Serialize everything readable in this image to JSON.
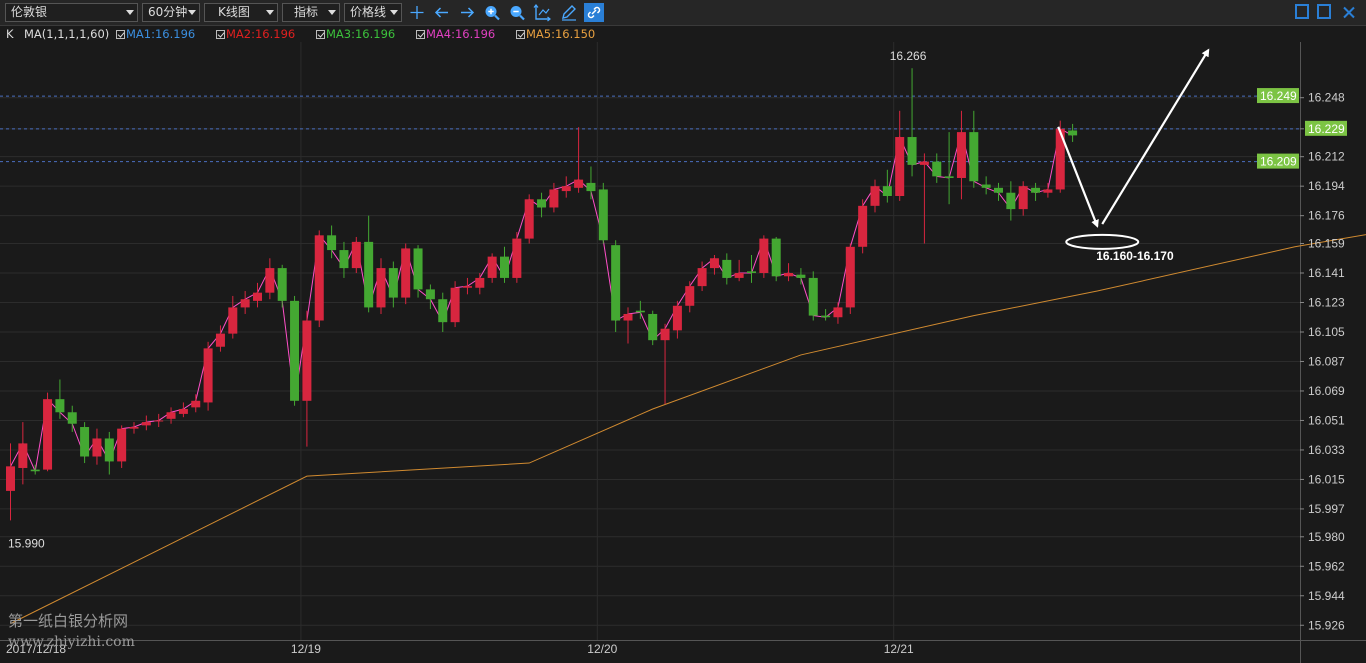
{
  "toolbar": {
    "symbol": "伦敦银",
    "period": "60分钟",
    "chart_kind": "K线图",
    "indicator": "指标",
    "price_line": "价格线"
  },
  "indicators": {
    "k": "K",
    "ma_params": "MA(1,1,1,1,60)",
    "ma1": "MA1:16.196",
    "ma2": "MA2:16.196",
    "ma3": "MA3:16.196",
    "ma4": "MA4:16.196",
    "ma5": "MA5:16.150"
  },
  "colors": {
    "bg": "#1a1a1a",
    "up": "#d8263f",
    "down": "#44a832",
    "ma1": "#3b8fe0",
    "ma2": "#e02020",
    "ma3": "#3cc23c",
    "ma4": "#e040c0",
    "ma5": "#e8a040",
    "ma_line": "#ff4fc8",
    "ma60_line": "#d08a30",
    "label_green": "#7cc444",
    "dashed": "#4a6fc0"
  },
  "watermark": {
    "line1": "第一纸白银分析网",
    "line2": "www.zhiyizhi.com"
  },
  "chart_data": {
    "type": "candlestick",
    "y_ticks": [
      16.248,
      16.229,
      16.212,
      16.194,
      16.176,
      16.159,
      16.141,
      16.123,
      16.105,
      16.087,
      16.069,
      16.051,
      16.033,
      16.015,
      15.997,
      15.98,
      15.962,
      15.944,
      15.926
    ],
    "ylim": [
      15.917,
      16.282
    ],
    "x_labels": [
      {
        "label": "2017/12/18",
        "index": 0
      },
      {
        "label": "12/19",
        "index": 24
      },
      {
        "label": "12/20",
        "index": 48
      },
      {
        "label": "12/21",
        "index": 72
      }
    ],
    "candles": [
      [
        16.008,
        16.023,
        16.037,
        15.99
      ],
      [
        16.022,
        16.037,
        16.05,
        16.012
      ],
      [
        16.021,
        16.02,
        16.024,
        16.018
      ],
      [
        16.021,
        16.064,
        16.068,
        16.02
      ],
      [
        16.064,
        16.056,
        16.076,
        16.052
      ],
      [
        16.056,
        16.049,
        16.06,
        16.044
      ],
      [
        16.047,
        16.029,
        16.05,
        16.025
      ],
      [
        16.029,
        16.04,
        16.046,
        16.024
      ],
      [
        16.04,
        16.026,
        16.044,
        16.018
      ],
      [
        16.026,
        16.046,
        16.048,
        16.022
      ],
      [
        16.046,
        16.047,
        16.05,
        16.043
      ],
      [
        16.048,
        16.05,
        16.054,
        16.045
      ],
      [
        16.051,
        16.051,
        16.055,
        16.047
      ],
      [
        16.052,
        16.056,
        16.059,
        16.049
      ],
      [
        16.055,
        16.058,
        16.062,
        16.053
      ],
      [
        16.059,
        16.063,
        16.067,
        16.056
      ],
      [
        16.062,
        16.095,
        16.099,
        16.057
      ],
      [
        16.096,
        16.104,
        16.109,
        16.093
      ],
      [
        16.104,
        16.12,
        16.127,
        16.101
      ],
      [
        16.12,
        16.125,
        16.13,
        16.116
      ],
      [
        16.124,
        16.129,
        16.135,
        16.12
      ],
      [
        16.129,
        16.144,
        16.15,
        16.125
      ],
      [
        16.144,
        16.124,
        16.146,
        16.12
      ],
      [
        16.124,
        16.063,
        16.127,
        16.06
      ],
      [
        16.063,
        16.112,
        16.118,
        16.035
      ],
      [
        16.112,
        16.164,
        16.167,
        16.108
      ],
      [
        16.164,
        16.155,
        16.17,
        16.15
      ],
      [
        16.155,
        16.144,
        16.16,
        16.138
      ],
      [
        16.144,
        16.16,
        16.163,
        16.141
      ],
      [
        16.16,
        16.12,
        16.176,
        16.117
      ],
      [
        16.12,
        16.144,
        16.15,
        16.116
      ],
      [
        16.144,
        16.126,
        16.148,
        16.12
      ],
      [
        16.126,
        16.156,
        16.159,
        16.122
      ],
      [
        16.156,
        16.131,
        16.158,
        16.126
      ],
      [
        16.131,
        16.125,
        16.134,
        16.119
      ],
      [
        16.125,
        16.111,
        16.129,
        16.105
      ],
      [
        16.111,
        16.132,
        16.136,
        16.108
      ],
      [
        16.132,
        16.133,
        16.138,
        16.128
      ],
      [
        16.132,
        16.138,
        16.141,
        16.128
      ],
      [
        16.138,
        16.151,
        16.153,
        16.135
      ],
      [
        16.151,
        16.138,
        16.157,
        16.135
      ],
      [
        16.138,
        16.162,
        16.166,
        16.135
      ],
      [
        16.162,
        16.186,
        16.189,
        16.159
      ],
      [
        16.186,
        16.181,
        16.19,
        16.175
      ],
      [
        16.181,
        16.192,
        16.196,
        16.178
      ],
      [
        16.191,
        16.194,
        16.2,
        16.187
      ],
      [
        16.193,
        16.198,
        16.23,
        16.19
      ],
      [
        16.196,
        16.191,
        16.206,
        16.186
      ],
      [
        16.192,
        16.161,
        16.196,
        16.159
      ],
      [
        16.158,
        16.112,
        16.161,
        16.105
      ],
      [
        16.112,
        16.116,
        16.12,
        16.098
      ],
      [
        16.118,
        16.117,
        16.124,
        16.113
      ],
      [
        16.116,
        16.1,
        16.118,
        16.097
      ],
      [
        16.1,
        16.107,
        16.11,
        16.061
      ],
      [
        16.106,
        16.121,
        16.124,
        16.101
      ],
      [
        16.121,
        16.133,
        16.136,
        16.117
      ],
      [
        16.133,
        16.144,
        16.148,
        16.13
      ],
      [
        16.144,
        16.15,
        16.152,
        16.14
      ],
      [
        16.149,
        16.138,
        16.153,
        16.134
      ],
      [
        16.138,
        16.141,
        16.149,
        16.136
      ],
      [
        16.142,
        16.141,
        16.152,
        16.135
      ],
      [
        16.141,
        16.162,
        16.164,
        16.138
      ],
      [
        16.162,
        16.139,
        16.163,
        16.136
      ],
      [
        16.139,
        16.141,
        16.147,
        16.136
      ],
      [
        16.14,
        16.138,
        16.144,
        16.134
      ],
      [
        16.138,
        16.115,
        16.142,
        16.112
      ],
      [
        16.115,
        16.114,
        16.119,
        16.112
      ],
      [
        16.114,
        16.12,
        16.123,
        16.11
      ],
      [
        16.12,
        16.157,
        16.159,
        16.116
      ],
      [
        16.157,
        16.182,
        16.186,
        16.153
      ],
      [
        16.182,
        16.194,
        16.198,
        16.178
      ],
      [
        16.194,
        16.188,
        16.204,
        16.184
      ],
      [
        16.188,
        16.224,
        16.24,
        16.185
      ],
      [
        16.224,
        16.207,
        16.266,
        16.2
      ],
      [
        16.207,
        16.209,
        16.214,
        16.159
      ],
      [
        16.209,
        16.2,
        16.214,
        16.196
      ],
      [
        16.2,
        16.199,
        16.227,
        16.183
      ],
      [
        16.199,
        16.227,
        16.24,
        16.186
      ],
      [
        16.227,
        16.197,
        16.24,
        16.193
      ],
      [
        16.195,
        16.193,
        16.2,
        16.189
      ],
      [
        16.193,
        16.19,
        16.196,
        16.185
      ],
      [
        16.19,
        16.18,
        16.197,
        16.173
      ],
      [
        16.18,
        16.194,
        16.197,
        16.176
      ],
      [
        16.193,
        16.19,
        16.196,
        16.185
      ],
      [
        16.19,
        16.192,
        16.196,
        16.187
      ],
      [
        16.192,
        16.229,
        16.234,
        16.19
      ],
      [
        16.228,
        16.225,
        16.232,
        16.221
      ]
    ],
    "ma60": [
      [
        0,
        15.927
      ],
      [
        24,
        16.017
      ],
      [
        42,
        16.025
      ],
      [
        52,
        16.058
      ],
      [
        64,
        16.091
      ],
      [
        78,
        16.115
      ],
      [
        88,
        16.13
      ],
      [
        104,
        16.157
      ],
      [
        118,
        16.175
      ],
      [
        128,
        16.183
      ]
    ],
    "annotations": {
      "high_label": "16.266",
      "low_label": "15.990",
      "target_text": "16.160-16.170",
      "price_tags": [
        "16.249",
        "16.229",
        "16.209"
      ],
      "h_lines": [
        16.249,
        16.229,
        16.209
      ]
    }
  }
}
